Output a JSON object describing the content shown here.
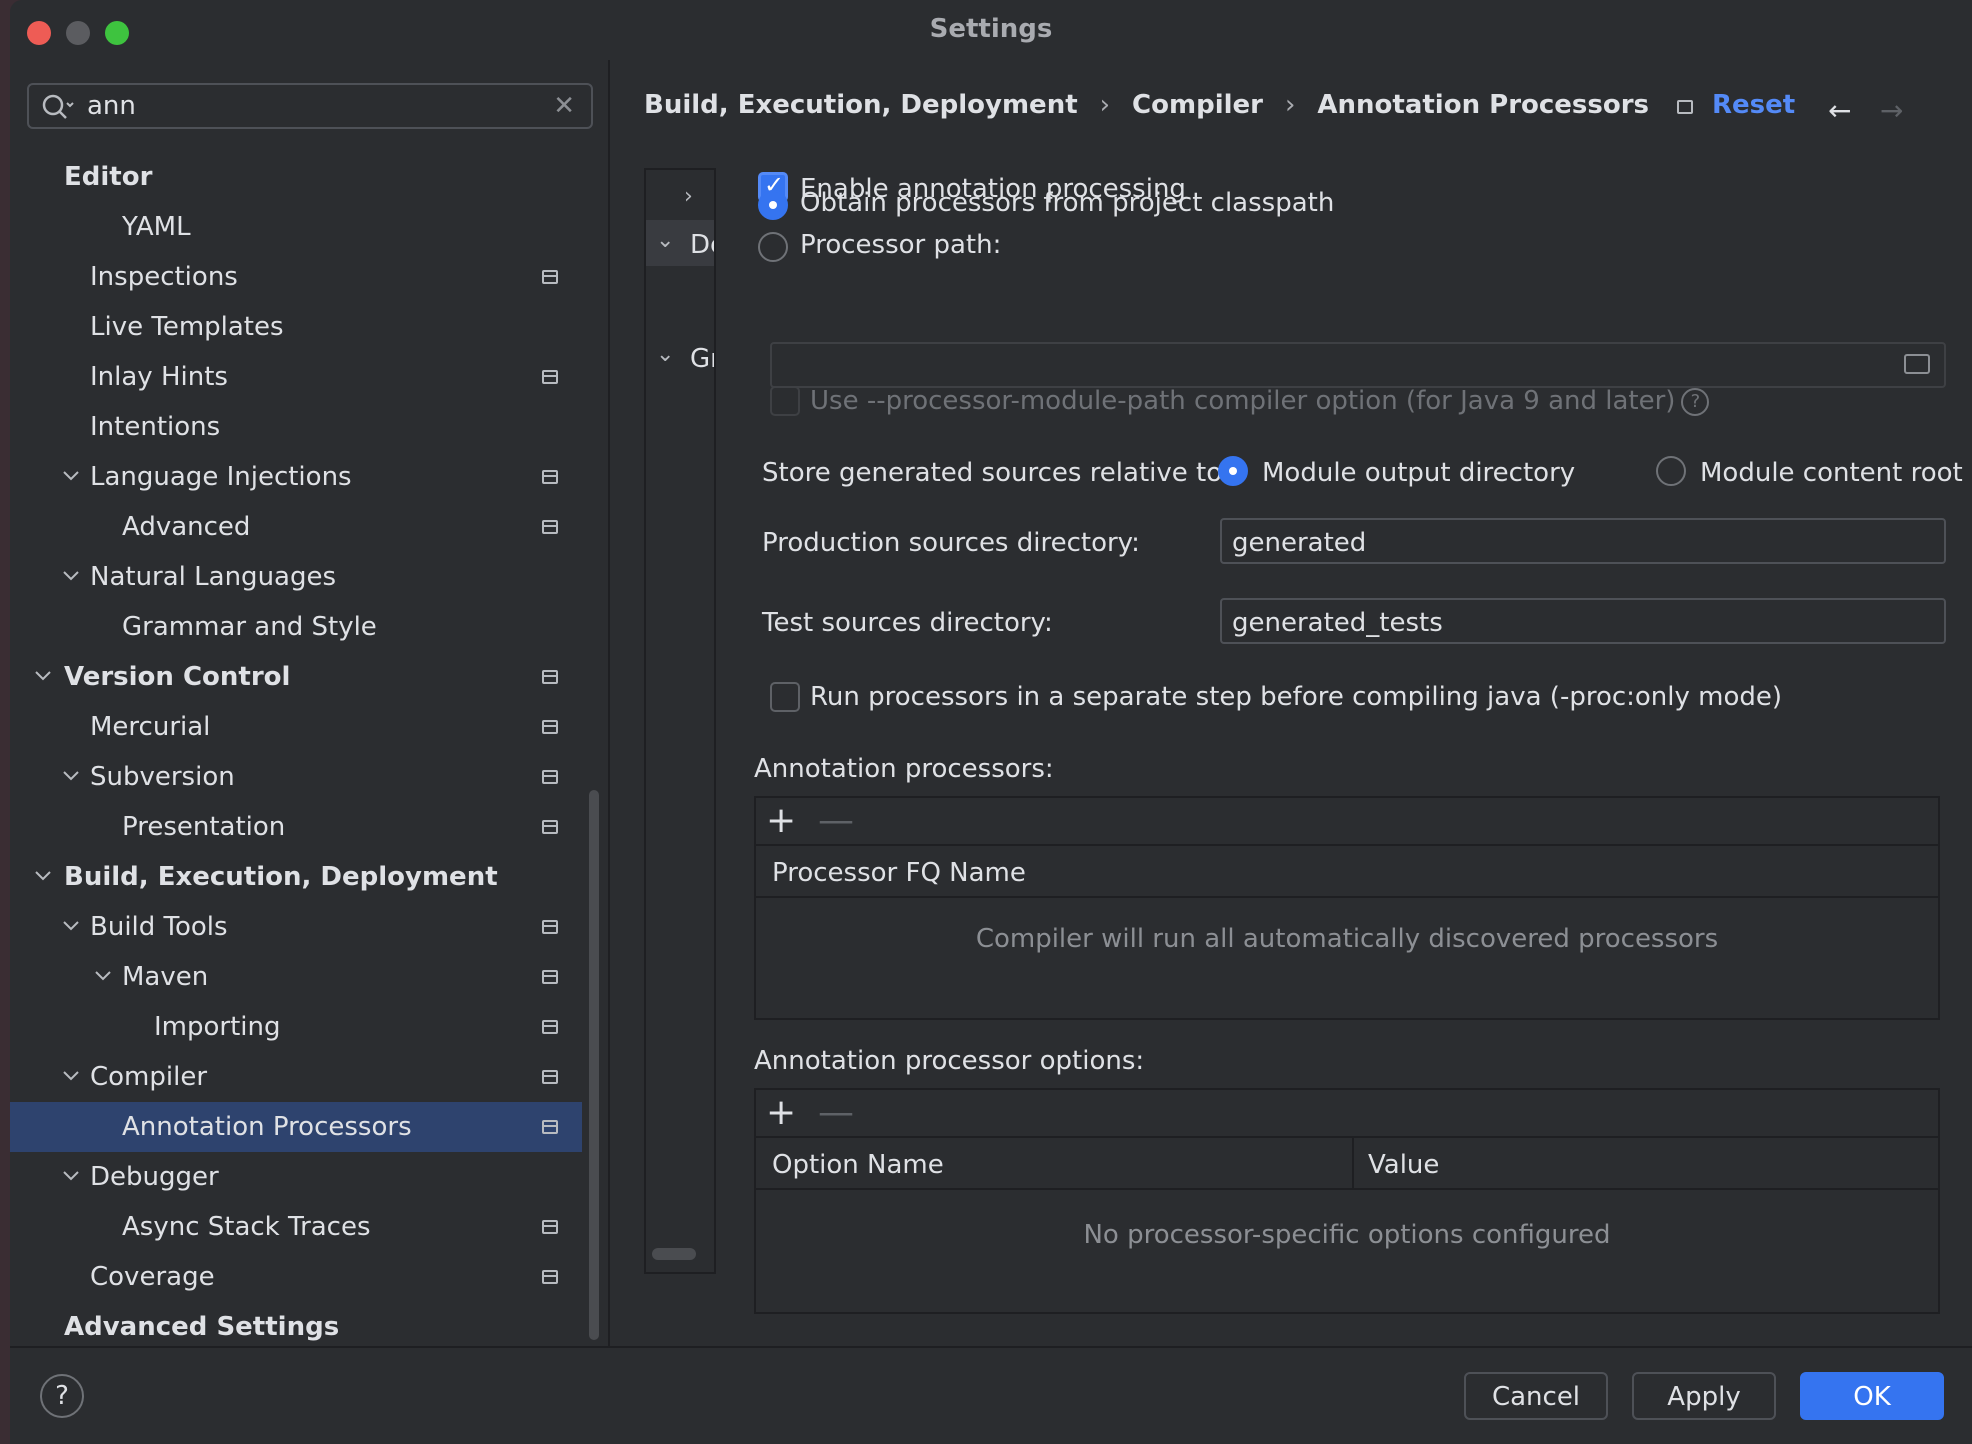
{
  "window": {
    "title": "Settings"
  },
  "sidebar": {
    "search": {
      "value": "ann"
    },
    "items": [
      {
        "label": "Editor",
        "level": 0,
        "bold": true,
        "expandable": false,
        "project": false
      },
      {
        "label": "YAML",
        "level": 2,
        "bold": false,
        "expandable": false,
        "project": false
      },
      {
        "label": "Inspections",
        "level": 1,
        "bold": false,
        "expandable": false,
        "project": true
      },
      {
        "label": "Live Templates",
        "level": 1,
        "bold": false,
        "expandable": false,
        "project": false
      },
      {
        "label": "Inlay Hints",
        "level": 1,
        "bold": false,
        "expandable": false,
        "project": true
      },
      {
        "label": "Intentions",
        "level": 1,
        "bold": false,
        "expandable": false,
        "project": false
      },
      {
        "label": "Language Injections",
        "level": 1,
        "bold": false,
        "expandable": true,
        "project": true
      },
      {
        "label": "Advanced",
        "level": 2,
        "bold": false,
        "expandable": false,
        "project": true
      },
      {
        "label": "Natural Languages",
        "level": 1,
        "bold": false,
        "expandable": true,
        "project": false
      },
      {
        "label": "Grammar and Style",
        "level": 2,
        "bold": false,
        "expandable": false,
        "project": false
      },
      {
        "label": "Version Control",
        "level": 0,
        "bold": true,
        "expandable": true,
        "project": true
      },
      {
        "label": "Mercurial",
        "level": 1,
        "bold": false,
        "expandable": false,
        "project": true
      },
      {
        "label": "Subversion",
        "level": 1,
        "bold": false,
        "expandable": true,
        "project": true
      },
      {
        "label": "Presentation",
        "level": 2,
        "bold": false,
        "expandable": false,
        "project": true
      },
      {
        "label": "Build, Execution, Deployment",
        "level": 0,
        "bold": true,
        "expandable": true,
        "project": false
      },
      {
        "label": "Build Tools",
        "level": 1,
        "bold": false,
        "expandable": true,
        "project": true
      },
      {
        "label": "Maven",
        "level": 2,
        "bold": false,
        "expandable": true,
        "project": true
      },
      {
        "label": "Importing",
        "level": 3,
        "bold": false,
        "expandable": false,
        "project": true
      },
      {
        "label": "Compiler",
        "level": 1,
        "bold": false,
        "expandable": true,
        "project": true
      },
      {
        "label": "Annotation Processors",
        "level": 2,
        "bold": false,
        "expandable": false,
        "project": true,
        "selected": true
      },
      {
        "label": "Debugger",
        "level": 1,
        "bold": false,
        "expandable": true,
        "project": false
      },
      {
        "label": "Async Stack Traces",
        "level": 2,
        "bold": false,
        "expandable": false,
        "project": true
      },
      {
        "label": "Coverage",
        "level": 1,
        "bold": false,
        "expandable": false,
        "project": true
      },
      {
        "label": "Advanced Settings",
        "level": 0,
        "bold": true,
        "expandable": false,
        "project": false
      }
    ]
  },
  "header": {
    "breadcrumb": [
      "Build, Execution, Deployment",
      "Compiler",
      "Annotation Processors"
    ],
    "reset_label": "Reset"
  },
  "profiles": {
    "rows": [
      {
        "chevron": "›",
        "label": ""
      },
      {
        "chevron": "⌄",
        "label": "De"
      },
      {
        "chevron": "⌄",
        "label": "Gr"
      }
    ]
  },
  "form": {
    "enable_label": "Enable annotation processing",
    "enable_checked": true,
    "obtain_label": "Obtain processors from project classpath",
    "processor_path_label": "Processor path:",
    "processor_path_value": "",
    "module_path_label": "Use --processor-module-path compiler option (for Java 9 and later)",
    "help_glyph": "?",
    "store_label": "Store generated sources relative to:",
    "module_output_label": "Module output directory",
    "module_content_label": "Module content root",
    "production_label": "Production sources directory:",
    "production_value": "generated",
    "test_label": "Test sources directory:",
    "test_value": "generated_tests",
    "separate_step_label": "Run processors in a separate step before compiling java (-proc:only mode)"
  },
  "processors_table": {
    "title": "Annotation processors:",
    "column": "Processor FQ Name",
    "empty_text": "Compiler will run all automatically discovered processors",
    "add_glyph": "+",
    "remove_glyph": "—"
  },
  "options_table": {
    "title": "Annotation processor options:",
    "columns": [
      "Option Name",
      "Value"
    ],
    "empty_text": "No processor-specific options configured",
    "add_glyph": "+",
    "remove_glyph": "—"
  },
  "footer": {
    "help_glyph": "?",
    "cancel_label": "Cancel",
    "apply_label": "Apply",
    "ok_label": "OK"
  },
  "colors": {
    "accent": "#3574f0",
    "link": "#548af7",
    "background": "#2b2d30",
    "selection": "#2e436e"
  }
}
